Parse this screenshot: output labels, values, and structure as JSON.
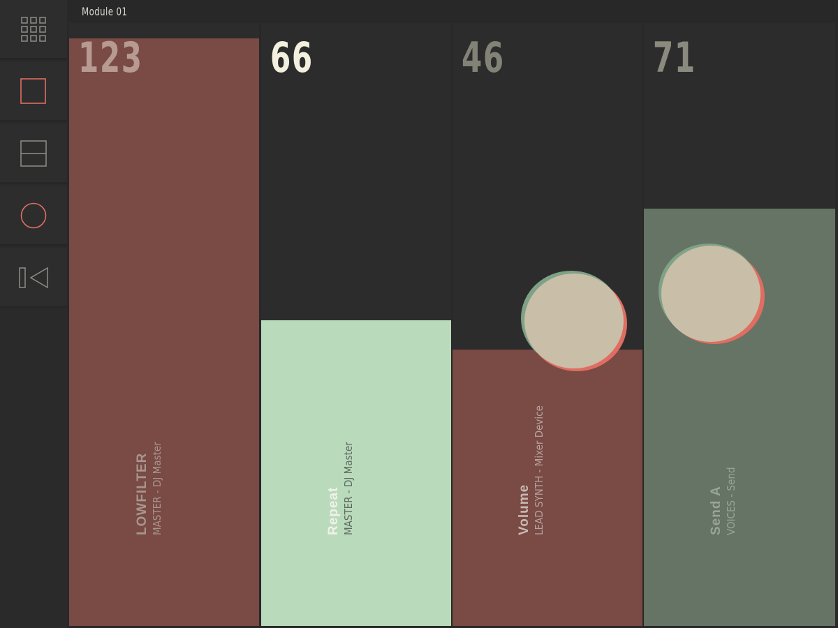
{
  "header": {
    "module_title": "Module 01"
  },
  "sidebar": {
    "items": [
      {
        "name": "grid-view-button",
        "icon": "grid-icon"
      },
      {
        "name": "fader-view-button",
        "icon": "square-icon",
        "active": true
      },
      {
        "name": "split-view-button",
        "icon": "split-rectangle-icon"
      },
      {
        "name": "knob-view-button",
        "icon": "circle-icon",
        "active": true
      },
      {
        "name": "transport-button",
        "icon": "rewind-icon"
      }
    ]
  },
  "faders": [
    {
      "value": "123",
      "name": "LOWFILTER",
      "subtitle": "MASTER - DJ Master",
      "level": 1.0,
      "fill_color": "#7a4a45",
      "value_color": "#b79a92",
      "name_color": "#a8958f",
      "sub_color": "#a8958f"
    },
    {
      "value": "66",
      "name": "Repeat",
      "subtitle": "MASTER - DJ Master",
      "level": 0.52,
      "fill_color": "#badabc",
      "value_color": "#f3f0de",
      "name_color": "#f2f1e8",
      "sub_color": "#5d6a5e"
    },
    {
      "value": "46",
      "name": "Volume",
      "subtitle": "LEAD SYNTH - Mixer Device",
      "level": 0.47,
      "fill_color": "#7a4a45",
      "value_color": "#828276",
      "name_color": "#c9b9b3",
      "sub_color": "#b7a49f"
    },
    {
      "value": "71",
      "name": "Send A",
      "subtitle": "VOICES - Send",
      "level": 0.71,
      "fill_color": "#657464",
      "value_color": "#8a8a7e",
      "name_color": "#9aa497",
      "sub_color": "#9aa497"
    }
  ],
  "colors": {
    "background": "#282828",
    "accent_red": "#e06d62",
    "accent_green": "#7fa287",
    "touch_blob": "#c9bea8"
  }
}
